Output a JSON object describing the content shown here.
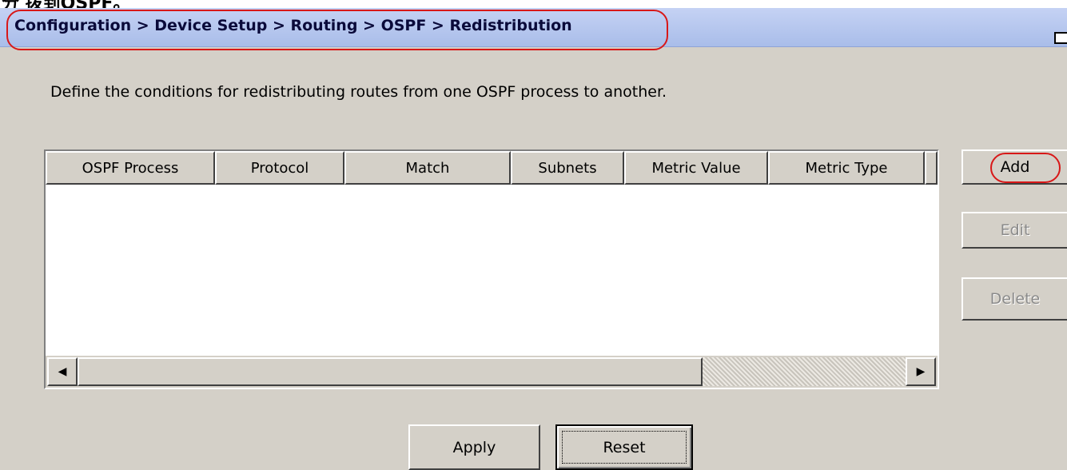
{
  "page_top_clip": "分 拨到OSPF。",
  "breadcrumb": "Configuration > Device Setup > Routing > OSPF > Redistribution",
  "description": "Define the conditions for redistributing routes from one OSPF process to another.",
  "table": {
    "columns": [
      "OSPF Process",
      "Protocol",
      "Match",
      "Subnets",
      "Metric Value",
      "Metric Type"
    ],
    "rows": []
  },
  "side_buttons": {
    "add": "Add",
    "edit": "Edit",
    "delete": "Delete"
  },
  "bottom_buttons": {
    "apply": "Apply",
    "reset": "Reset"
  },
  "icons": {
    "scroll_left": "scroll-left-arrow-icon",
    "scroll_right": "scroll-right-arrow-icon",
    "window": "window-restore-icon"
  },
  "colors": {
    "header_bar": "#b7c7ef",
    "highlight": "#d81818",
    "panel_bg": "#d4d0c8"
  }
}
